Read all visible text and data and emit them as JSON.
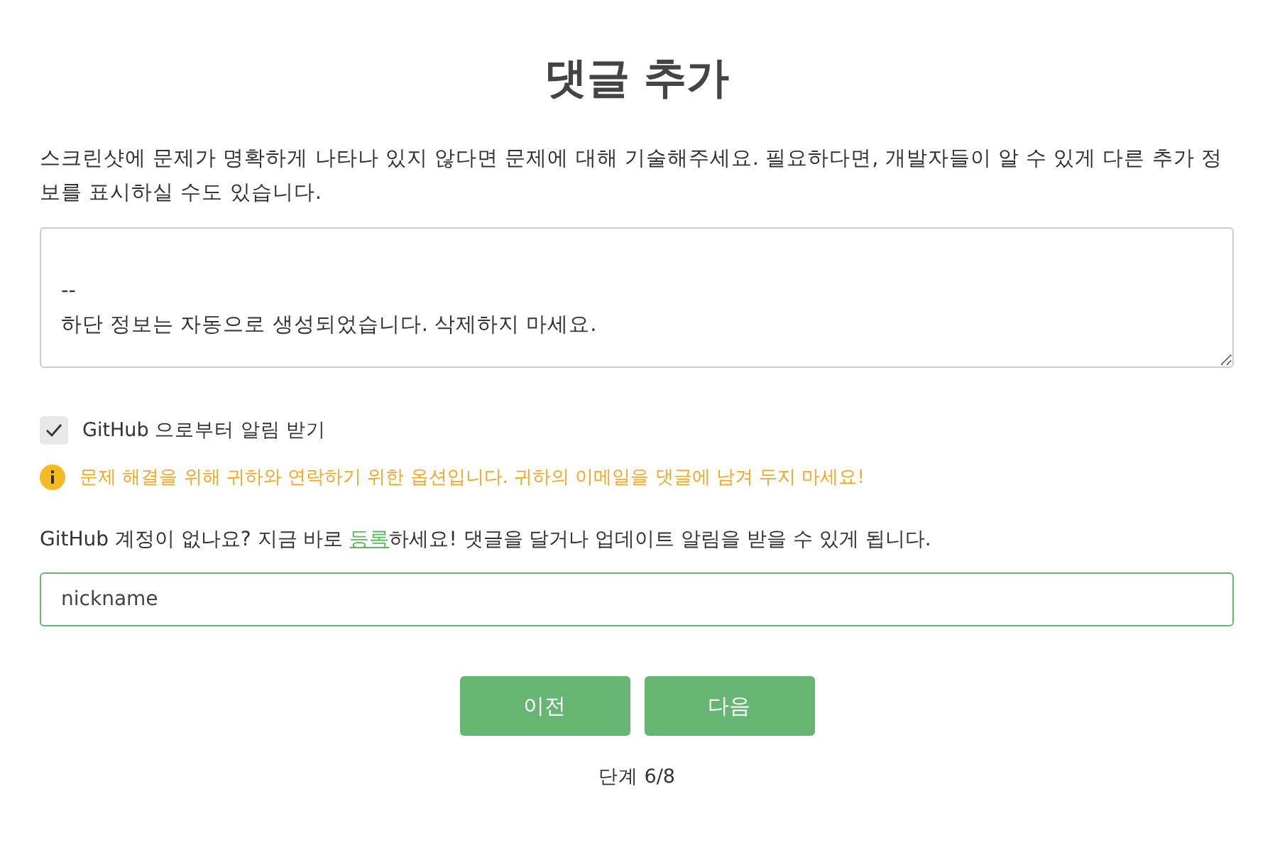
{
  "title": "댓글 추가",
  "description": "스크린샷에 문제가 명확하게 나타나 있지 않다면 문제에 대해 기술해주세요. 필요하다면, 개발자들이 알 수 있게 다른 추가 정보를 표시하실 수도 있습니다.",
  "comment": {
    "value": "\n--\n하단 정보는 자동으로 생성되었습니다. 삭제하지 마세요."
  },
  "notify": {
    "label": "GitHub 으로부터 알림 받기",
    "checked": true
  },
  "notice": "문제 해결을 위해 귀하와 연락하기 위한 옵션입니다. 귀하의 이메일을 댓글에 남겨 두지 마세요!",
  "signup": {
    "before": "GitHub 계정이 없나요? 지금 바로 ",
    "link": "등록",
    "after": "하세요! 댓글을 달거나 업데이트 알림을 받을 수 있게 됩니다."
  },
  "nickname": {
    "value": "nickname"
  },
  "buttons": [
    "이전",
    "다음"
  ],
  "step": "단계 6/8"
}
